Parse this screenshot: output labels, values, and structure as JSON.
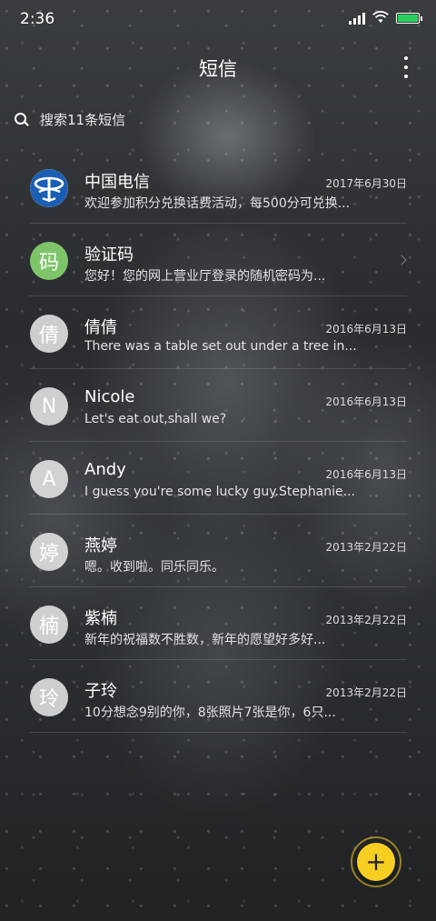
{
  "status_bar": {
    "time": "2:36",
    "battery_color": "#2bd061"
  },
  "header": {
    "title": "短信",
    "more_icon": "more-vertical-icon"
  },
  "search": {
    "placeholder": "搜索11条短信",
    "icon": "search-icon"
  },
  "conversations": [
    {
      "avatar_text": "",
      "avatar_kind": "telecom-logo",
      "name": "中国电信",
      "date": "2017年6月30日",
      "preview": "欢迎参加积分兑换话费活动，每500分可兑换..."
    },
    {
      "avatar_text": "码",
      "avatar_kind": "green",
      "name": "验证码",
      "date": "",
      "preview": "您好！您的网上营业厅登录的随机密码为...",
      "has_chevron": true
    },
    {
      "avatar_text": "倩",
      "avatar_kind": "gray",
      "name": "倩倩",
      "date": "2016年6月13日",
      "preview": "There was a table set out under a tree in..."
    },
    {
      "avatar_text": "N",
      "avatar_kind": "gray",
      "name": "Nicole",
      "date": "2016年6月13日",
      "preview": "Let's eat out,shall we?"
    },
    {
      "avatar_text": "A",
      "avatar_kind": "gray",
      "name": "Andy",
      "date": "2016年6月13日",
      "preview": "I guess you're some lucky guy.Stephanie..."
    },
    {
      "avatar_text": "婷",
      "avatar_kind": "gray",
      "name": "燕婷",
      "date": "2013年2月22日",
      "preview": "嗯。收到啦。同乐同乐。"
    },
    {
      "avatar_text": "楠",
      "avatar_kind": "gray",
      "name": "紫楠",
      "date": "2013年2月22日",
      "preview": "新年的祝福数不胜数，新年的愿望好多好..."
    },
    {
      "avatar_text": "玲",
      "avatar_kind": "gray",
      "name": "子玲",
      "date": "2013年2月22日",
      "preview": "10分想念9别的你，8张照片7张是你，6只..."
    }
  ],
  "fab": {
    "label": "+",
    "color": "#f7cf23"
  }
}
